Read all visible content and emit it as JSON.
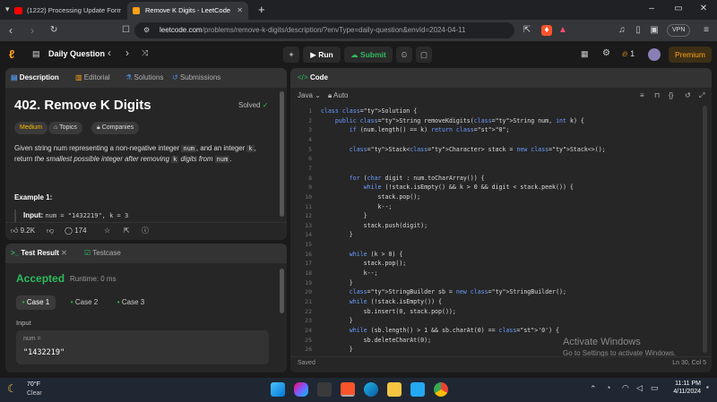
{
  "browser": {
    "tabs": [
      {
        "title": "(1222) Processing Update Form with"
      },
      {
        "title": "Remove K Digits - LeetCode"
      }
    ],
    "url_host": "leetcode.com",
    "url_path": "/problems/remove-k-digits/description/?envType=daily-question&envId=2024-04-11",
    "vpn_label": "VPN"
  },
  "header": {
    "title": "Daily Question",
    "run_label": "Run",
    "submit_label": "Submit",
    "streak": "1",
    "premium_label": "Premium"
  },
  "desc_panel": {
    "tabs": [
      "Description",
      "Editorial",
      "Solutions",
      "Submissions"
    ],
    "title": "402. Remove K Digits",
    "solved_label": "Solved",
    "tags": [
      "Medium",
      "Topics",
      "Companies"
    ],
    "statement": {
      "p1": "Given string num representing a non-negative integer",
      "code1": "num",
      "p2": ", and an integer",
      "code2": "k",
      "p3": ",",
      "p4": "return",
      "em1": "the smallest possible integer after removing",
      "code3": "k",
      "em2": "digits from",
      "code4": "num",
      "p5": "."
    },
    "example_label": "Example 1:",
    "example_input_label": "Input:",
    "example_input_value": "num = \"1432219\", k = 3",
    "likes": "9.2K",
    "comments": "174"
  },
  "test_panel": {
    "tabs": [
      "Test Result",
      "Testcase"
    ],
    "status": "Accepted",
    "runtime": "Runtime: 0 ms",
    "cases": [
      "Case 1",
      "Case 2",
      "Case 3"
    ],
    "input_label": "Input",
    "var_label": "num =",
    "var_value": "\"1432219\""
  },
  "code_panel": {
    "title": "Code",
    "language": "Java",
    "mode": "Auto",
    "line_numbers": [
      "1",
      "2",
      "3",
      "4",
      "5",
      "6",
      "7",
      "8",
      "9",
      "10",
      "11",
      "12",
      "13",
      "14",
      "15",
      "16",
      "17",
      "18",
      "19",
      "20",
      "21",
      "22",
      "23",
      "24",
      "25",
      "26"
    ],
    "lines": [
      "class Solution {",
      "    public String removeKdigits(String num, int k) {",
      "        if (num.length() == k) return \"0\";",
      "",
      "        Stack<Character> stack = new Stack<>();",
      "",
      "",
      "        for (char digit : num.toCharArray()) {",
      "            while (!stack.isEmpty() && k > 0 && digit < stack.peek()) {",
      "                stack.pop();",
      "                k--;",
      "            }",
      "            stack.push(digit);",
      "        }",
      "",
      "        while (k > 0) {",
      "            stack.pop();",
      "            k--;",
      "        }",
      "        StringBuilder sb = new StringBuilder();",
      "        while (!stack.isEmpty()) {",
      "            sb.insert(0, stack.pop());",
      "        }",
      "        while (sb.length() > 1 && sb.charAt(0) == '0') {",
      "            sb.deleteCharAt(0);",
      "        }"
    ],
    "saved_label": "Saved",
    "cursor_pos": "Ln 30, Col 5"
  },
  "watermark": {
    "line1": "Activate Windows",
    "line2": "Go to Settings to activate Windows."
  },
  "taskbar": {
    "weather_temp": "70°F",
    "weather_desc": "Clear",
    "time": "11:11 PM",
    "date": "4/11/2024"
  },
  "colors": {
    "accepted": "#2cbb5d",
    "medium": "#ffb800",
    "submit": "#2cbb5d",
    "premium": "#ffa116"
  }
}
